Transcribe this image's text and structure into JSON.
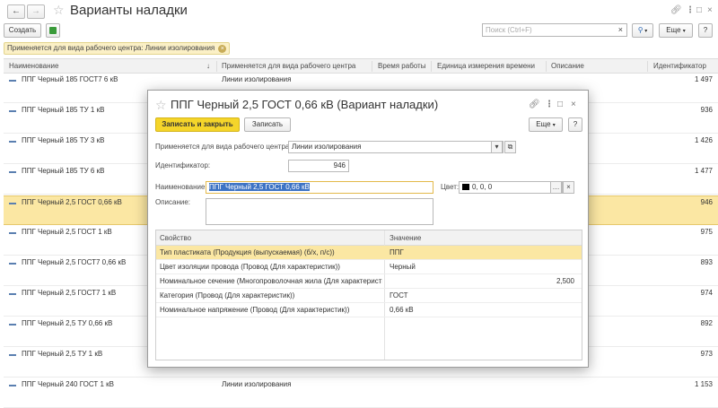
{
  "window": {
    "title": "Варианты наладки"
  },
  "toolbar": {
    "create_label": "Создать",
    "search_placeholder": "Поиск (Ctrl+F)",
    "more_label": "Еще",
    "help_label": "?"
  },
  "filter": {
    "label": "Применяется для вида рабочего центра: Линии изолирования"
  },
  "columns": {
    "name": "Наименование",
    "sort": "↓",
    "workcenter": "Применяется для вида рабочего центра",
    "worktime": "Время работы",
    "unit": "Единица измерения времени",
    "desc": "Описание",
    "id": "Идентификатор"
  },
  "rows": [
    {
      "name": "ППГ Черный 185 ГОСТ7 6 кВ",
      "workcenter": "Линии изолирования",
      "id": "1 497"
    },
    {
      "name": "ППГ Черный 185 ТУ 1 кВ",
      "workcenter": "",
      "id": "936"
    },
    {
      "name": "ППГ Черный 185 ТУ 3 кВ",
      "workcenter": "",
      "id": "1 426"
    },
    {
      "name": "ППГ Черный 185 ТУ 6 кВ",
      "workcenter": "",
      "id": "1 477"
    },
    {
      "name": "ППГ Черный 2,5 ГОСТ 0,66 кВ",
      "workcenter": "",
      "id": "946"
    },
    {
      "name": "ППГ Черный 2,5 ГОСТ 1 кВ",
      "workcenter": "",
      "id": "975"
    },
    {
      "name": "ППГ Черный 2,5 ГОСТ7 0,66 кВ",
      "workcenter": "",
      "id": "893"
    },
    {
      "name": "ППГ Черный 2,5 ГОСТ7 1 кВ",
      "workcenter": "",
      "id": "974"
    },
    {
      "name": "ППГ Черный 2,5 ТУ 0,66 кВ",
      "workcenter": "",
      "id": "892"
    },
    {
      "name": "ППГ Черный 2,5 ТУ 1 кВ",
      "workcenter": "",
      "id": "973"
    },
    {
      "name": "ППГ Черный 240 ГОСТ 1 кВ",
      "workcenter": "Линии изолирования",
      "id": "1 153"
    }
  ],
  "modal": {
    "title": "ППГ Черный 2,5 ГОСТ 0,66 кВ (Вариант наладки)",
    "save_close_label": "Записать и закрыть",
    "save_label": "Записать",
    "more_label": "Еще",
    "help_label": "?",
    "workcenter_label": "Применяется для вида рабочего центра:",
    "workcenter_value": "Линии изолирования",
    "id_label": "Идентификатор:",
    "id_value": "946",
    "name_label": "Наименование:",
    "name_value": "ППГ Черный 2,5 ГОСТ 0,66 кВ",
    "color_label": "Цвет:",
    "color_value": "0, 0, 0",
    "desc_label": "Описание:",
    "props_header_name": "Свойство",
    "props_header_value": "Значение",
    "props": [
      {
        "name": "Тип пластиката (Продукция (выпускаемая) (б/х, п/с))",
        "value": "ППГ"
      },
      {
        "name": "Цвет изоляции провода (Провод (Для характеристик))",
        "value": "Черный"
      },
      {
        "name": "Номинальное сечение (Многопроволочная жила (Для характеристик))",
        "value": "2,500"
      },
      {
        "name": "Категория (Провод (Для характеристик))",
        "value": "ГОСТ"
      },
      {
        "name": "Номинальное напряжение (Провод (Для характеристик))",
        "value": "0,66 кВ"
      }
    ]
  },
  "colors": {
    "accent_yellow": "#f5d52a",
    "selection": "#fbe7a3",
    "link_blue": "#2f6bb5"
  },
  "icons": [
    "back-arrow-icon",
    "forward-arrow-icon",
    "star-icon",
    "link-icon",
    "more-vert-icon",
    "maximize-icon",
    "close-icon",
    "green-save-icon",
    "search-icon",
    "clear-icon",
    "dropdown-icon",
    "open-icon",
    "ellipsis-icon",
    "clear-icon"
  ]
}
